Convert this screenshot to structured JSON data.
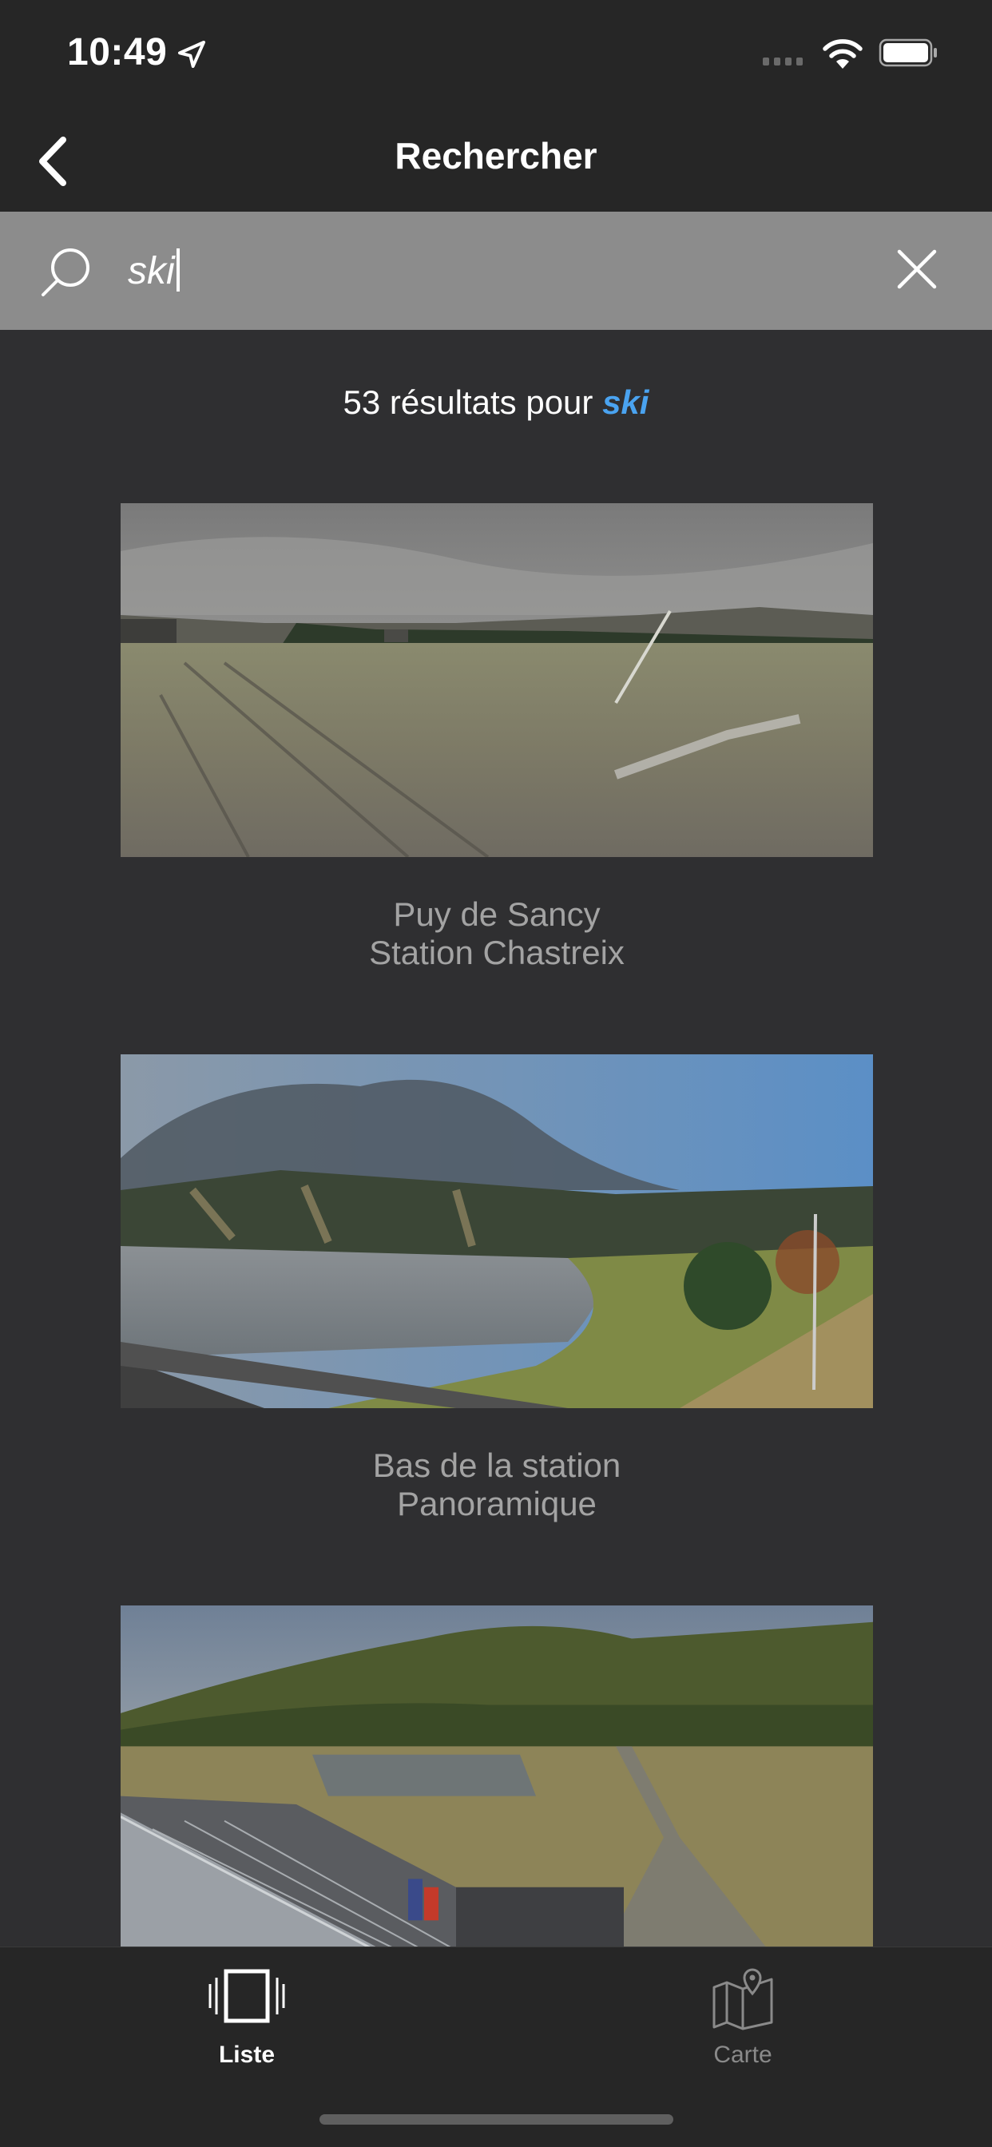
{
  "status_bar": {
    "time": "10:49"
  },
  "nav": {
    "title": "Rechercher"
  },
  "search": {
    "value": "ski"
  },
  "results": {
    "count_text": "53 résultats pour ",
    "query": "ski"
  },
  "cards": [
    {
      "line1": "Puy de Sancy",
      "line2": "Station Chastreix"
    },
    {
      "line1": "Bas de la station",
      "line2": "Panoramique"
    },
    {
      "line1": "",
      "line2": ""
    }
  ],
  "tabs": [
    {
      "label": "Liste",
      "active": true,
      "icon": "list-icon"
    },
    {
      "label": "Carte",
      "active": false,
      "icon": "map-icon"
    }
  ],
  "colors": {
    "accent": "#4aa3f0",
    "background": "#2f2f31",
    "bars": "#262626",
    "search_bar": "#8c8c8c"
  }
}
